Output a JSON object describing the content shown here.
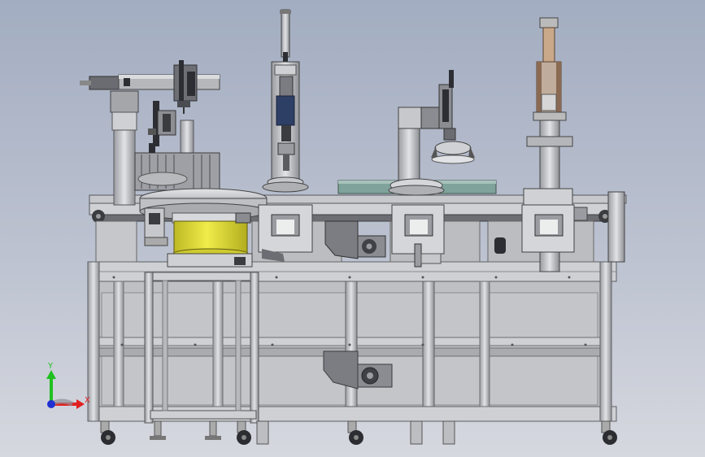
{
  "viewport": {
    "background_top": "#a3adc1",
    "background_bottom": "#d6d8df"
  },
  "colors": {
    "frame": "#c9cacc",
    "frame_dark": "#8d8f94",
    "frame_edge": "#5e6066",
    "panel": "#bfc0c3",
    "yellow_feeder": "#e6e235",
    "conveyor_belt": "#7fa39a",
    "axis_x": "#e02020",
    "axis_y": "#20c020",
    "axis_z": "#2030d0"
  },
  "triad": {
    "x_label": "X",
    "y_label": "Y",
    "icon": "coordinate-triad-icon"
  },
  "model": {
    "name": "automated-assembly-station",
    "modules": [
      "vibratory-feeder",
      "linear-gantry",
      "pressing-cylinder-1",
      "rotary-gripper",
      "pressing-cylinder-2",
      "transfer-conveyor"
    ]
  }
}
